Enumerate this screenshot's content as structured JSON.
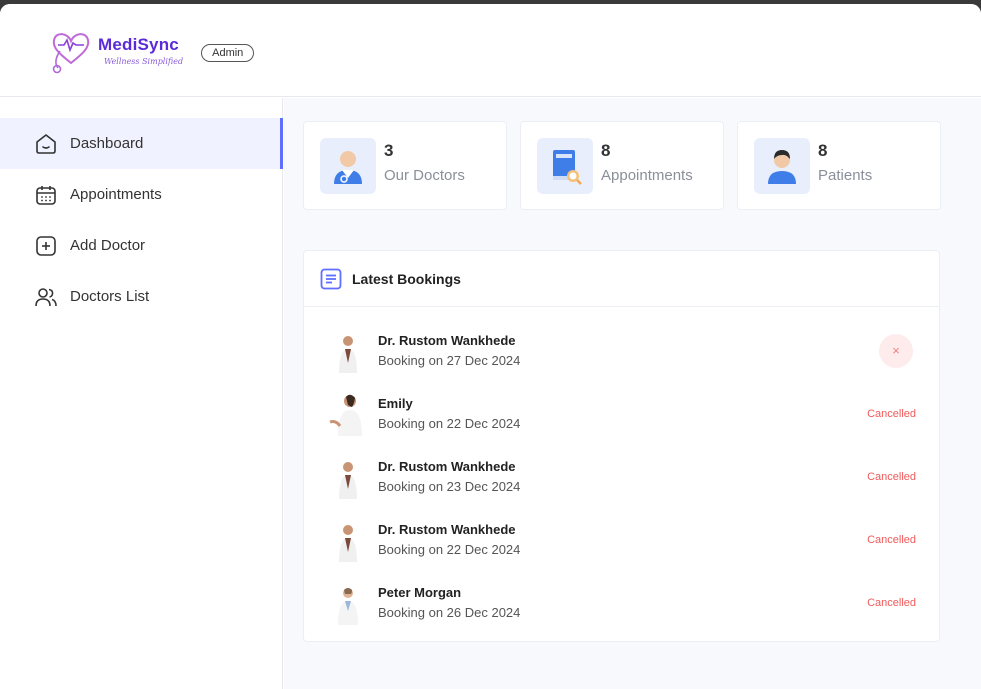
{
  "brand": {
    "name": "MediSync",
    "tagline": "Wellness Simplified",
    "role": "Admin",
    "accent": "#5f6fff"
  },
  "sidebar": {
    "items": [
      {
        "label": "Dashboard",
        "icon": "home-icon",
        "active": true
      },
      {
        "label": "Appointments",
        "icon": "calendar-icon",
        "active": false
      },
      {
        "label": "Add Doctor",
        "icon": "add-square-icon",
        "active": false
      },
      {
        "label": "Doctors List",
        "icon": "people-icon",
        "active": false
      }
    ]
  },
  "stats": [
    {
      "value": "3",
      "label": "Our Doctors",
      "icon": "doctor-icon"
    },
    {
      "value": "8",
      "label": "Appointments",
      "icon": "appointment-book-icon"
    },
    {
      "value": "8",
      "label": "Patients",
      "icon": "patient-icon"
    }
  ],
  "bookings": {
    "title": "Latest Bookings",
    "rows": [
      {
        "name": "Dr. Rustom Wankhede",
        "date": "Booking on 27 Dec 2024",
        "status": "",
        "action": "×"
      },
      {
        "name": "Emily",
        "date": "Booking on 22 Dec 2024",
        "status": "Cancelled"
      },
      {
        "name": "Dr. Rustom Wankhede",
        "date": "Booking on 23 Dec 2024",
        "status": "Cancelled"
      },
      {
        "name": "Dr. Rustom Wankhede",
        "date": "Booking on 22 Dec 2024",
        "status": "Cancelled"
      },
      {
        "name": "Peter Morgan",
        "date": "Booking on 26 Dec 2024",
        "status": "Cancelled"
      }
    ]
  }
}
